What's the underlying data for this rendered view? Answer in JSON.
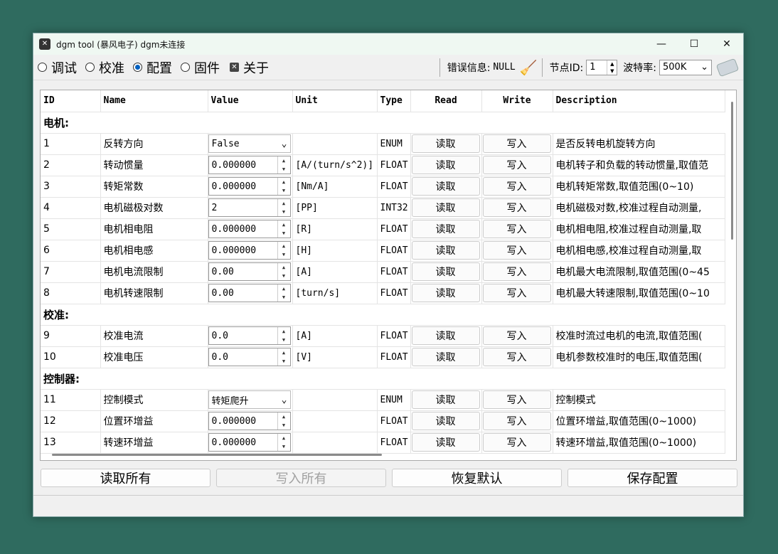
{
  "window": {
    "title": "dgm tool (暴风电子)  dgm未连接",
    "min_icon": "—",
    "max_icon": "☐",
    "close_icon": "✕"
  },
  "toolbar": {
    "modes": [
      {
        "label": "调试",
        "selected": false
      },
      {
        "label": "校准",
        "selected": false
      },
      {
        "label": "配置",
        "selected": true
      },
      {
        "label": "固件",
        "selected": false
      }
    ],
    "about_label": "关于",
    "error_label": "错误信息:",
    "error_value": "NULL",
    "node_label": "节点ID:",
    "node_value": "1",
    "baud_label": "波特率:",
    "baud_value": "500K"
  },
  "table": {
    "headers": [
      "ID",
      "Name",
      "Value",
      "Unit",
      "Type",
      "Read",
      "Write",
      "Description"
    ],
    "groups": {
      "motor": "电机:",
      "calib": "校准:",
      "controller": "控制器:"
    },
    "read_label": "读取",
    "write_label": "写入",
    "rows": [
      {
        "id": "1",
        "name": "反转方向",
        "value": "False",
        "unit": "",
        "type": "ENUM",
        "desc": "是否反转电机旋转方向"
      },
      {
        "id": "2",
        "name": "转动惯量",
        "value": "0.000000",
        "unit": "[A/(turn/s^2)]",
        "type": "FLOAT",
        "desc": "电机转子和负载的转动惯量,取值范"
      },
      {
        "id": "3",
        "name": "转矩常数",
        "value": "0.000000",
        "unit": "[Nm/A]",
        "type": "FLOAT",
        "desc": "电机转矩常数,取值范围(0~10)"
      },
      {
        "id": "4",
        "name": "电机磁极对数",
        "value": "2",
        "unit": "[PP]",
        "type": "INT32",
        "desc": "电机磁极对数,校准过程自动测量,"
      },
      {
        "id": "5",
        "name": "电机相电阻",
        "value": "0.000000",
        "unit": "[R]",
        "type": "FLOAT",
        "desc": "电机相电阻,校准过程自动测量,取"
      },
      {
        "id": "6",
        "name": "电机相电感",
        "value": "0.000000",
        "unit": "[H]",
        "type": "FLOAT",
        "desc": "电机相电感,校准过程自动测量,取"
      },
      {
        "id": "7",
        "name": "电机电流限制",
        "value": "0.00",
        "unit": "[A]",
        "type": "FLOAT",
        "desc": "电机最大电流限制,取值范围(0~45"
      },
      {
        "id": "8",
        "name": "电机转速限制",
        "value": "0.00",
        "unit": "[turn/s]",
        "type": "FLOAT",
        "desc": "电机最大转速限制,取值范围(0~10"
      },
      {
        "id": "9",
        "name": "校准电流",
        "value": "0.0",
        "unit": "[A]",
        "type": "FLOAT",
        "desc": "校准时流过电机的电流,取值范围("
      },
      {
        "id": "10",
        "name": "校准电压",
        "value": "0.0",
        "unit": "[V]",
        "type": "FLOAT",
        "desc": "电机参数校准时的电压,取值范围("
      },
      {
        "id": "11",
        "name": "控制模式",
        "value": "转矩爬升",
        "unit": "",
        "type": "ENUM",
        "desc": "控制模式"
      },
      {
        "id": "12",
        "name": "位置环增益",
        "value": "0.000000",
        "unit": "",
        "type": "FLOAT",
        "desc": "位置环增益,取值范围(0~1000)"
      },
      {
        "id": "13",
        "name": "转速环增益",
        "value": "0.000000",
        "unit": "",
        "type": "FLOAT",
        "desc": "转速环增益,取值范围(0~1000)"
      }
    ]
  },
  "bottom": {
    "read_all": "读取所有",
    "write_all": "写入所有",
    "restore": "恢复默认",
    "save": "保存配置"
  }
}
